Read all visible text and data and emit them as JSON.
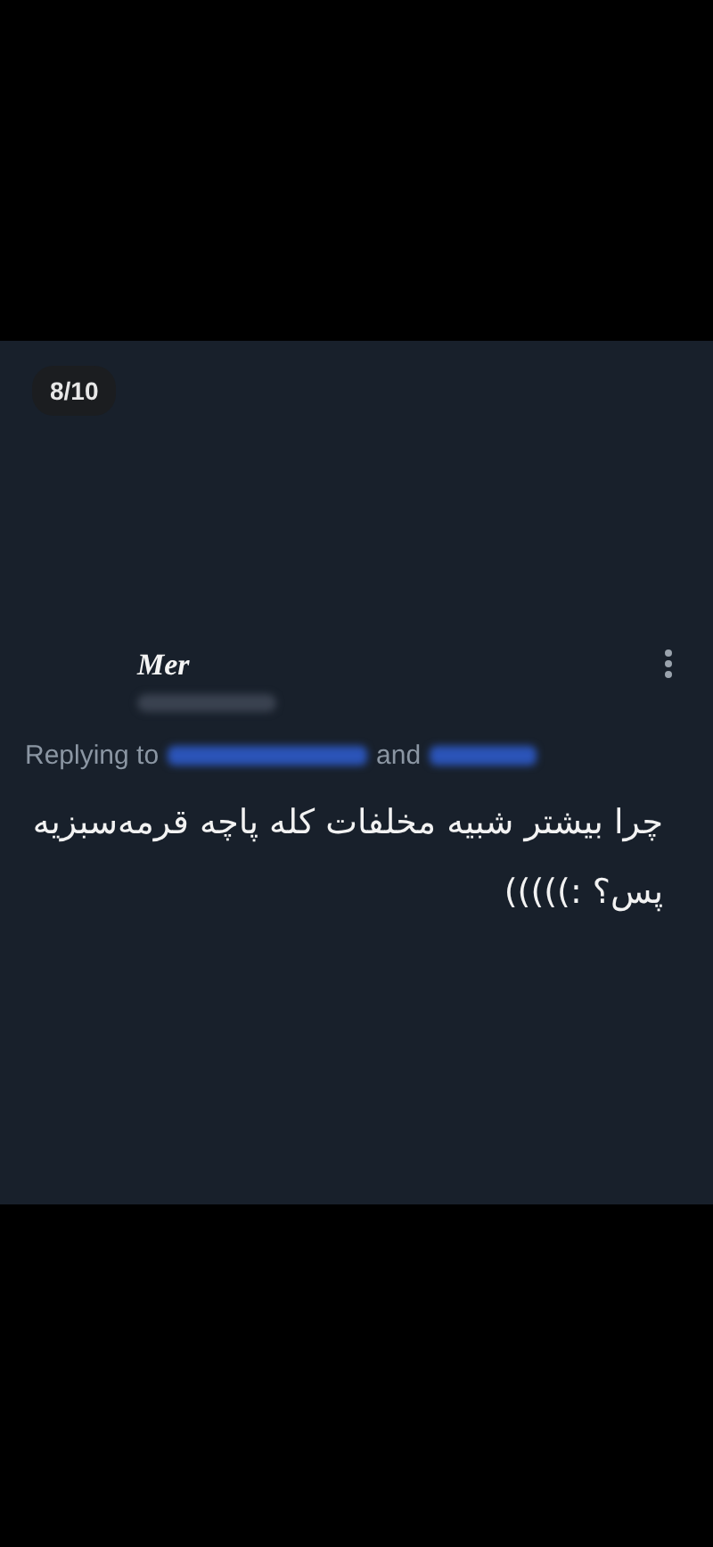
{
  "counter": "8/10",
  "tweet": {
    "name": "Mer",
    "replying_prefix": "Replying to",
    "replying_joiner": "and",
    "text": "چرا بیشتر شبیه مخلفات کله پاچه قرمه‌سبزیه پس؟ :)))))"
  }
}
